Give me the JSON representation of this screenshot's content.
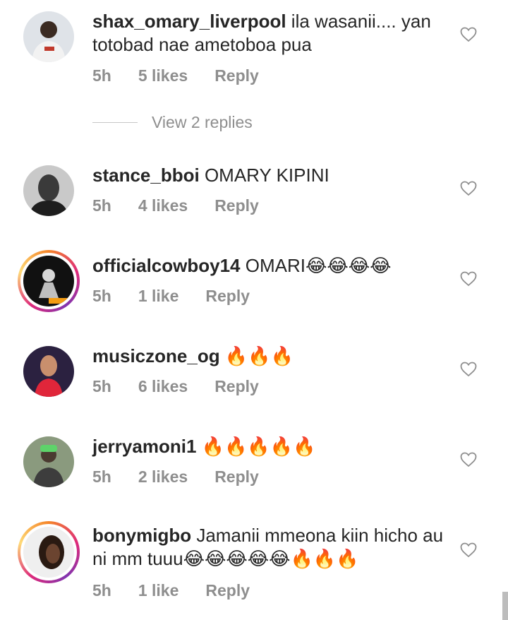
{
  "comments": [
    {
      "username": "shax_omary_liverpool",
      "text": " ila wasanii.... yan totobad nae ametoboa pua",
      "time": "5h",
      "likes": "5 likes",
      "reply": "Reply"
    },
    {
      "username": "stance_bboi",
      "text": " OMARY KIPINI",
      "time": "5h",
      "likes": "4 likes",
      "reply": "Reply"
    },
    {
      "username": "officialcowboy14",
      "text": " OMARI😂😂😂😂",
      "time": "5h",
      "likes": "1 like",
      "reply": "Reply"
    },
    {
      "username": "musiczone_og",
      "text": " 🔥🔥🔥",
      "time": "5h",
      "likes": "6 likes",
      "reply": "Reply"
    },
    {
      "username": "jerryamoni1",
      "text": " 🔥🔥🔥🔥🔥",
      "time": "5h",
      "likes": "2 likes",
      "reply": "Reply"
    },
    {
      "username": "bonymigbo",
      "text": " Jamanii mmeona kiin hicho au ni mm tuuu😂😂😂😂😂🔥🔥🔥",
      "time": "5h",
      "likes": "1 like",
      "reply": "Reply"
    }
  ],
  "view_replies": "View 2 replies",
  "colors": {
    "text": "#262626",
    "meta": "#8e8e8e"
  }
}
